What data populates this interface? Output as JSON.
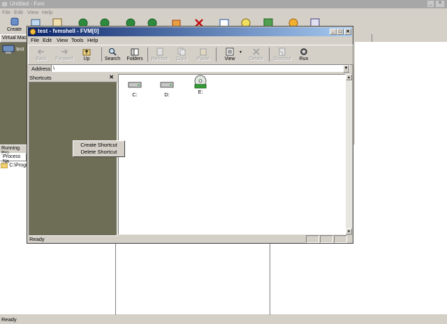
{
  "bg_app": {
    "title": "Untitled - Fvm",
    "menu": [
      "File",
      "Edit",
      "View",
      "Help"
    ],
    "create_label": "Create",
    "virtual_label": "Virtual Mac",
    "vm_item": "test",
    "running_label": "Running Pro",
    "process_header": "Process Na",
    "process_item": "C:\\Progr",
    "status": "Ready"
  },
  "window": {
    "title": "test - fvmshell - FVM[0]",
    "menu": [
      "File",
      "Edit",
      "View",
      "Tools",
      "Help"
    ],
    "toolbar": {
      "back": "Back",
      "forward": "Forward",
      "up": "Up",
      "search": "Search",
      "folders": "Folders",
      "refresh": "Refresh",
      "copy": "Copy",
      "paste": "Paste",
      "view": "View",
      "delete": "Delete",
      "shortcut": "Shortcut",
      "run": "Run"
    },
    "address_label": "Address",
    "address_value": "\\",
    "shortcuts_title": "Shortcuts",
    "drives": [
      "C:",
      "D:",
      "E:"
    ],
    "status": "Ready"
  },
  "context_menu": {
    "items": [
      "Create Shortcut",
      "Delete Shortcut"
    ]
  },
  "colors": {
    "title_active": "#0a246a",
    "panel_olive": "#6e6e57",
    "chrome": "#d4d0c8"
  }
}
